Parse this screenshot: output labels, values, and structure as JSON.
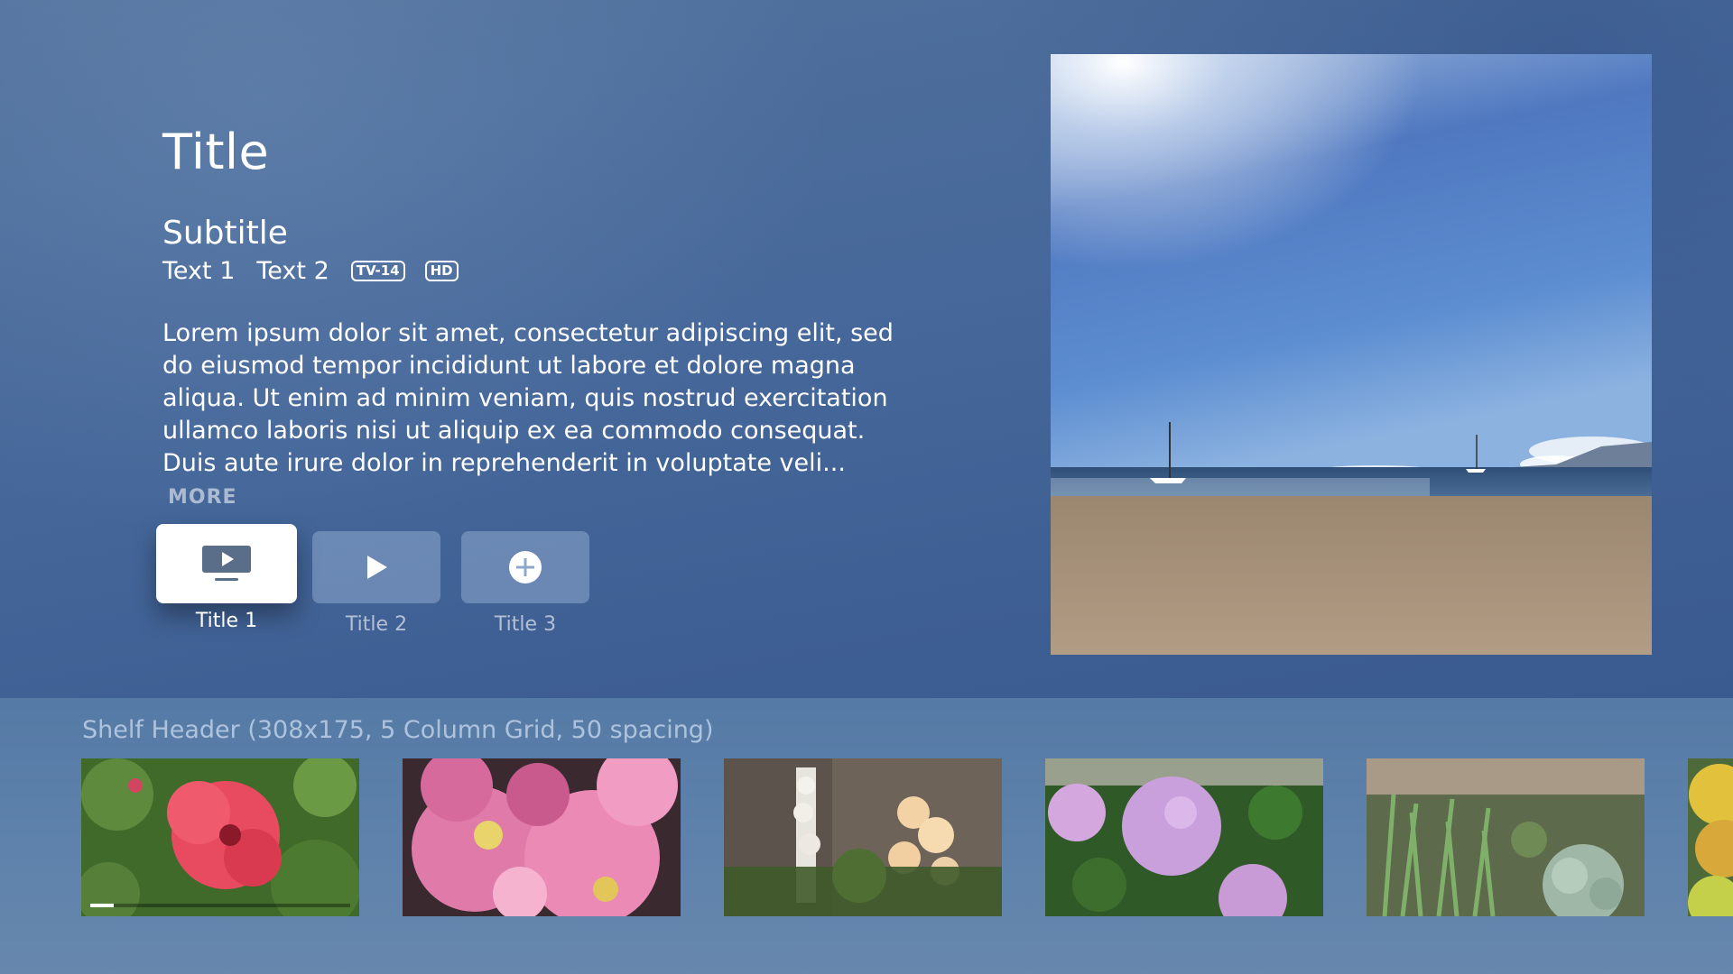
{
  "header": {
    "title": "Title",
    "subtitle": "Subtitle",
    "meta": [
      "Text 1",
      "Text 2"
    ],
    "badges": [
      "TV-14",
      "HD"
    ]
  },
  "description": {
    "text": "Lorem ipsum dolor sit amet, consectetur adipiscing elit, sed do eiusmod tempor incididunt ut labore et dolore magna aliqua. Ut enim ad minim veniam, quis nostrud exercitation ullamco laboris nisi ut aliquip ex ea commodo consequat. Duis aute irure dolor in reprehenderit in voluptate veli...",
    "more_label": "MORE"
  },
  "actions": [
    {
      "label": "Title 1",
      "icon": "tv-play-icon",
      "focused": true
    },
    {
      "label": "Title 2",
      "icon": "play-icon",
      "focused": false
    },
    {
      "label": "Title 3",
      "icon": "add-circle-icon",
      "focused": false
    }
  ],
  "hero": {
    "image": "beach-sailboats-image"
  },
  "shelf": {
    "header": "Shelf Header (308x175, 5 Column Grid, 50 spacing)",
    "items": [
      {
        "image": "red-hibiscus-image",
        "progress": 0.09
      },
      {
        "image": "pink-peonies-image"
      },
      {
        "image": "foxglove-flowers-image"
      },
      {
        "image": "purple-hydrangea-image"
      },
      {
        "image": "succulents-image"
      },
      {
        "image": "mangoes-image"
      }
    ]
  },
  "colors": {
    "background": "#46689a",
    "shelf_background": "#5f83ac",
    "focused_tile": "#ffffff",
    "unfocused_tile": "#8ea8cc"
  }
}
